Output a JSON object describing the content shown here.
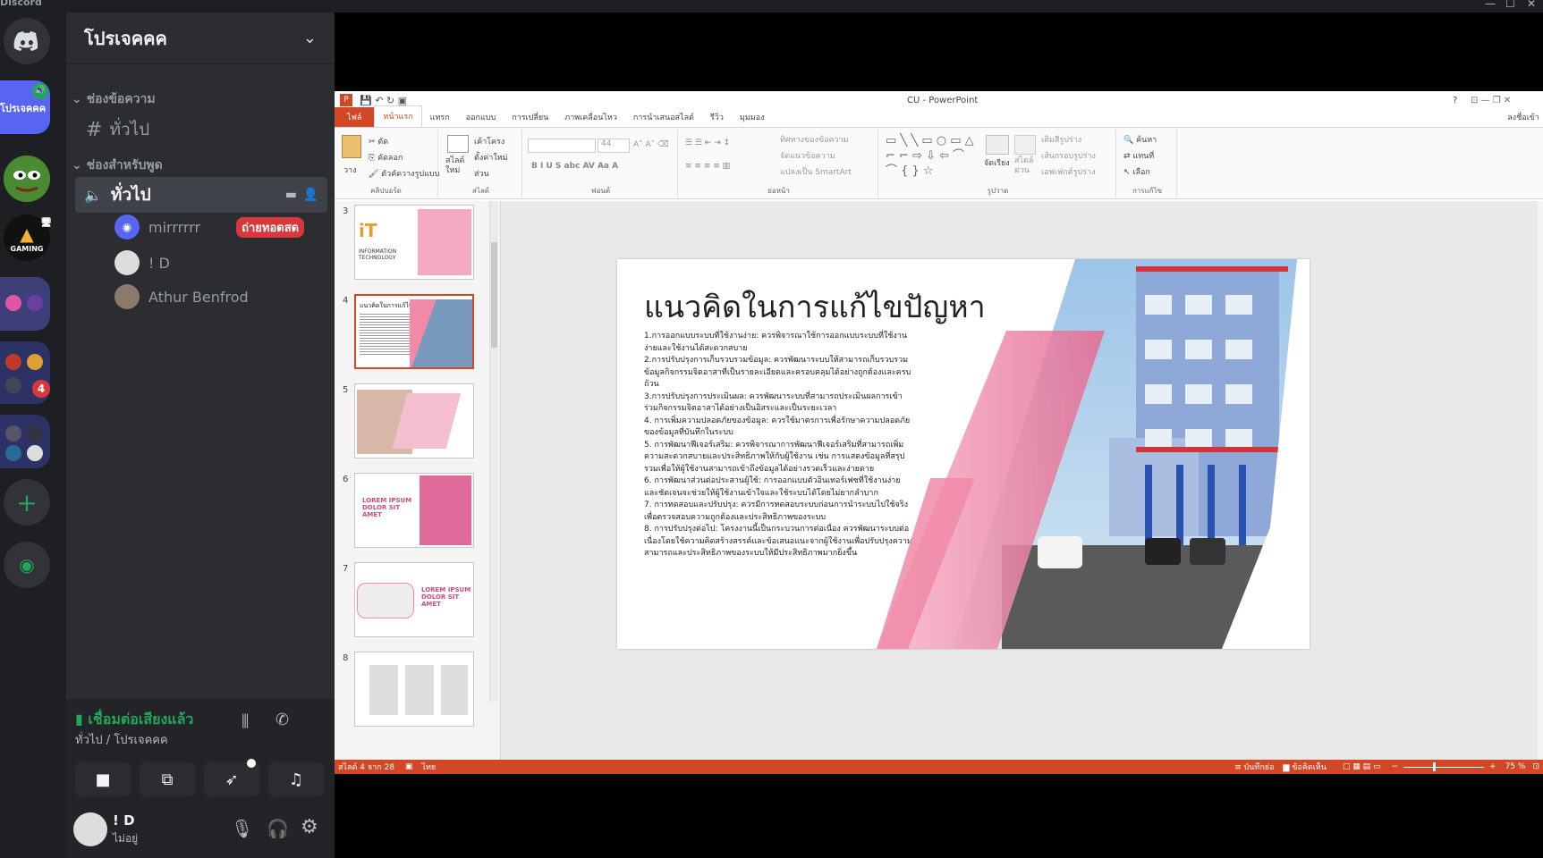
{
  "window": {
    "app_name": "Discord",
    "min": "—",
    "max": "☐",
    "close": "✕"
  },
  "guilds": {
    "home_icon": "discord-logo-icon",
    "server_active_label": "โปรเจคคค",
    "server_gaming_label": "GAMING",
    "badge_count": "4",
    "add_label": "+",
    "explore_label": "◉"
  },
  "server": {
    "name": "โปรเจคคค",
    "chevron": "⌄"
  },
  "categories": {
    "text": "ช่องข้อความ",
    "voice": "ช่องสำหรับพูด"
  },
  "text_channel": {
    "hash": "#",
    "name": "ทั่วไป"
  },
  "voice_channel": {
    "name": "ทั่วไป"
  },
  "voice_users": [
    {
      "name": "mirrrrrr",
      "live": "ถ่ายทอดสด"
    },
    {
      "name": "! D"
    },
    {
      "name": "Athur Benfrod"
    }
  ],
  "voice_panel": {
    "status": "เชื่อมต่อเสียงแล้ว",
    "location": "ทั่วไป / โปรเจคคค"
  },
  "user_panel": {
    "name": "! D",
    "status": "ไม่อยู่"
  },
  "ppt": {
    "title": "CU - PowerPoint",
    "help": "?",
    "signin": "ลงชื่อเข้า",
    "tabs": [
      "ไฟล์",
      "หน้าแรก",
      "แทรก",
      "ออกแบบ",
      "การเปลี่ยน",
      "ภาพเคลื่อนไหว",
      "การนำเสนอสไลด์",
      "รีวิว",
      "มุมมอง"
    ],
    "groups": [
      "คลิปบอร์ด",
      "สไลด์",
      "ฟอนต์",
      "ย่อหน้า",
      "รูปวาด",
      "การแก้ไข"
    ],
    "clipboard": {
      "paste": "วาง",
      "cut": "ตัด",
      "copy": "คัดลอก",
      "format": "ตัวคัดวางรูปแบบ"
    },
    "slides": {
      "new": "สไลด์ใหม่",
      "layout": "เค้าโครง",
      "reset": "ตั้งค่าใหม่",
      "section": "ส่วน"
    },
    "font": {
      "size": "44"
    },
    "paragraph": {
      "direction": "ทิศทางของข้อความ",
      "align": "จัดแนวข้อความ",
      "smartart": "แปลงเป็น SmartArt"
    },
    "drawing": {
      "arrange": "จัดเรียง",
      "styles": "สไตล์ด่วน",
      "fill": "เติมสีรูปร่าง",
      "outline": "เส้นกรอบรูปร่าง",
      "effects": "เอฟเฟกต์รูปร่าง"
    },
    "editing": {
      "find": "ค้นหา",
      "replace": "แทนที่",
      "select": "เลือก"
    },
    "thumb_numbers": [
      "3",
      "4",
      "5",
      "6",
      "7",
      "8"
    ],
    "thumb3_caption": "INFORMATION TECHNOLOGY",
    "thumb_lorem": "LOREM IPSUM DOLOR SIT AMET",
    "slide_title": "แนวคิดในการแก้ไขปัญหา",
    "slide_body": [
      "1.การออกแบบระบบที่ใช้งานง่าย: ควรพิจารณาใช้การออกแบบระบบที่ใช้งานง่ายและใช้งานได้สะดวกสบาย",
      "2.การปรับปรุงการเก็บรวบรวมข้อมูล: ควรพัฒนาระบบให้สามารถเก็บรวบรวมข้อมูลกิจกรรมจิตอาสาที่เป็นรายละเอียดและครอบคลุมได้อย่างถูกต้องและครบถ้วน",
      "3.การปรับปรุงการประเมินผล: ควรพัฒนาระบบที่สามารถประเมินผลการเข้าร่วมกิจกรรมจิตอาสาได้อย่างเป็นอิสระและเป็นระยะเวลา",
      "4. การเพิ่มความปลอดภัยของข้อมูล: ควรใช้มาตรการเพื่อรักษาความปลอดภัยของข้อมูลที่บันทึกในระบบ",
      "5. การพัฒนาฟีเจอร์เสริม: ควรพิจารณาการพัฒนาฟีเจอร์เสริมที่สามารถเพิ่มความสะดวกสบายและประสิทธิภาพให้กับผู้ใช้งาน เช่น การแสดงข้อมูลที่สรุปรวมเพื่อให้ผู้ใช้งานสามารถเข้าถึงข้อมูลได้อย่างรวดเร็วและง่ายดาย",
      "6. การพัฒนาส่วนต่อประสานผู้ใช้: การออกแบบตัวอินเทอร์เฟซที่ใช้งานง่ายและชัดเจนจะช่วยให้ผู้ใช้งานเข้าใจและใช้ระบบได้โดยไม่ยากลำบาก",
      "7. การทดสอบและปรับปรุง: ควรมีการทดสอบระบบก่อนการนำระบบไปใช้จริงเพื่อตรวจสอบความถูกต้องและประสิทธิภาพของระบบ",
      "8. การปรับปรุงต่อไป: โครงงานนี้เป็นกระบวนการต่อเนื่อง ควรพัฒนาระบบต่อเนื่องโดยใช้ความคิดสร้างสรรค์และข้อเสนอแนะจากผู้ใช้งานเพื่อปรับปรุงความสามารถและประสิทธิภาพของระบบให้มีประสิทธิภาพมากยิ่งขึ้น"
    ],
    "status": {
      "slide": "สไลด์ 4 จาก 28",
      "lang": "ไทย",
      "notes": "บันทึกย่อ",
      "comments": "ข้อคิดเห็น",
      "zoom": "75 %"
    },
    "zoom_value": 75
  },
  "colors": {
    "accent_ppt": "#d24726",
    "discord_blurple": "#5865f2",
    "live_red": "#da373c",
    "voice_green": "#23a55a"
  }
}
